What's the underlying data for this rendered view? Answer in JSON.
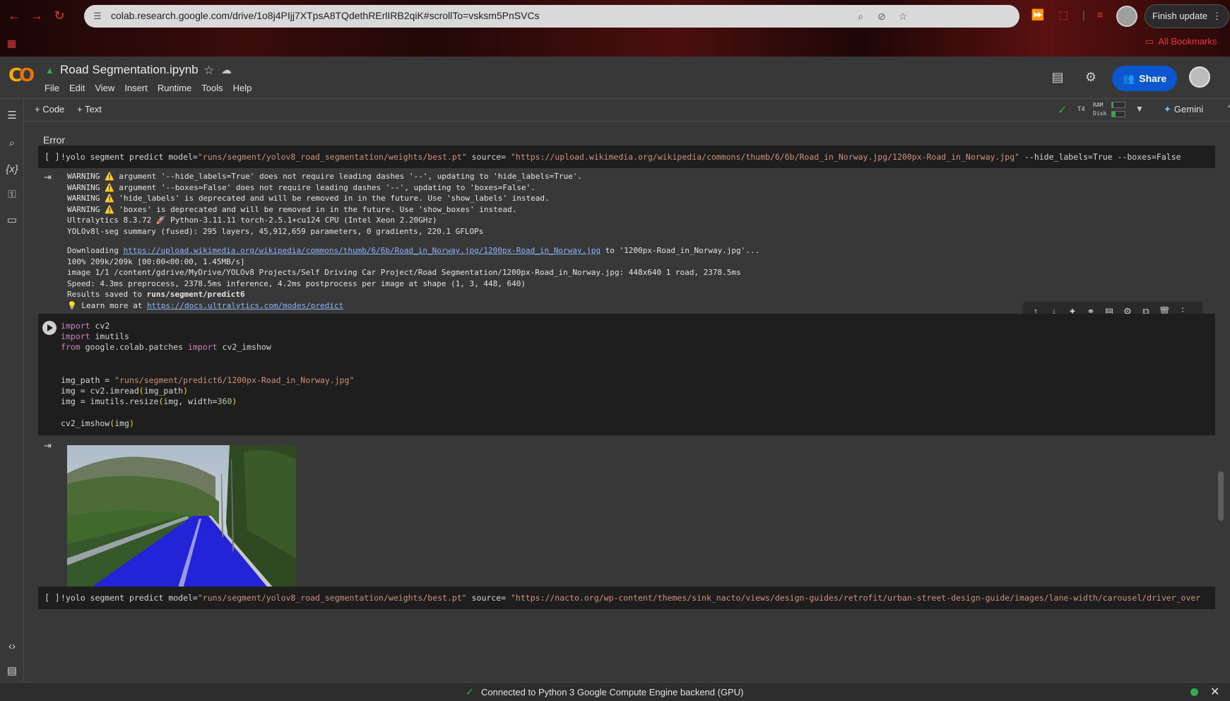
{
  "browser": {
    "url": "colab.research.google.com/drive/1o8j4PIjj7XTpsA8TQdethRErlIRB2qiK#scrollTo=vsksm5PnSVCs",
    "finish_update_label": "Finish update",
    "bookmarks_label": "All Bookmarks"
  },
  "colab": {
    "notebook_title": "Road Segmentation.ipynb",
    "menu": [
      "File",
      "Edit",
      "View",
      "Insert",
      "Runtime",
      "Tools",
      "Help"
    ],
    "share_label": "Share",
    "add_code_label": "+ Code",
    "add_text_label": "+ Text",
    "runtime_type": "T4",
    "ram_label": "RAM",
    "disk_label": "Disk",
    "ram_usage_fraction": 0.1,
    "disk_usage_fraction": 0.3,
    "gemini_label": "Gemini",
    "accent_color": "#0b57d0"
  },
  "notebook": {
    "error_label": "Error",
    "cell1": {
      "exec_count": "[ ]",
      "prefix": "!yolo segment predict model=",
      "model_path": "\"runs/segment/yolov8_road_segmentation/weights/best.pt\"",
      "source_kw": " source= ",
      "source_url": "\"https://upload.wikimedia.org/wikipedia/commons/thumb/6/6b/Road_in_Norway.jpg/1200px-Road_in_Norway.jpg\"",
      "flags": " --hide_labels=True --boxes=False"
    },
    "output1": {
      "lines": [
        "WARNING ⚠️ argument '--hide_labels=True' does not require leading dashes '--', updating to 'hide_labels=True'.",
        "WARNING ⚠️ argument '--boxes=False' does not require leading dashes '--', updating to 'boxes=False'.",
        "WARNING ⚠️ 'hide_labels' is deprecated and will be removed in in the future. Use 'show_labels' instead.",
        "WARNING ⚠️ 'boxes' is deprecated and will be removed in in the future. Use 'show_boxes' instead.",
        "Ultralytics 8.3.72 🚀 Python-3.11.11 torch-2.5.1+cu124 CPU (Intel Xeon 2.20GHz)",
        "YOLOv8l-seg summary (fused): 295 layers, 45,912,659 parameters, 0 gradients, 220.1 GFLOPs"
      ],
      "download_prefix": "Downloading ",
      "download_url": "https://upload.wikimedia.org/wikipedia/commons/thumb/6/6b/Road_in_Norway.jpg/1200px-Road_in_Norway.jpg",
      "download_suffix": " to '1200px-Road_in_Norway.jpg'...",
      "lines2": [
        "100% 209k/209k [00:00<00:00, 1.45MB/s]",
        "image 1/1 /content/gdrive/MyDrive/YOLOv8 Projects/Self Driving Car Project/Road Segmentation/1200px-Road_in_Norway.jpg: 448x640 1 road, 2378.5ms",
        "Speed: 4.3ms preprocess, 2378.5ms inference, 4.2ms postprocess per image at shape (1, 3, 448, 640)"
      ],
      "results_prefix": "Results saved to ",
      "results_path": "runs/segment/predict6",
      "learn_prefix": "💡 Learn more at ",
      "learn_url": "https://docs.ultralytics.com/modes/predict"
    },
    "cell2": {
      "import1_kw": "import",
      "import1_mod": " cv2",
      "import2_kw": "import",
      "import2_mod": " imutils",
      "from_kw": "from",
      "from_mod": " google.colab.patches ",
      "from_import_kw": "import",
      "from_name": " cv2_imshow",
      "img_path_lhs": "img_path = ",
      "img_path_val": "\"runs/segment/predict6/1200px-Road_in_Norway.jpg\"",
      "imread_lhs": "img = cv2.imread",
      "imread_arg": "img_path",
      "resize_lhs": "img = imutils.resize",
      "resize_arg1": "img, width=",
      "resize_num": "360",
      "imshow_fn": "cv2_imshow",
      "imshow_arg": "img"
    },
    "cell3": {
      "exec_count": "[ ]",
      "prefix": "!yolo segment predict model=",
      "model_path": "\"runs/segment/yolov8_road_segmentation/weights/best.pt\"",
      "source_kw": " source= ",
      "source_url": "\"https://nacto.org/wp-content/themes/sink_nacto/views/design-guides/retrofit/urban-street-design-guide/images/lane-width/carousel/driver_over"
    }
  },
  "status": {
    "text": "Connected to Python 3 Google Compute Engine backend (GPU)"
  }
}
